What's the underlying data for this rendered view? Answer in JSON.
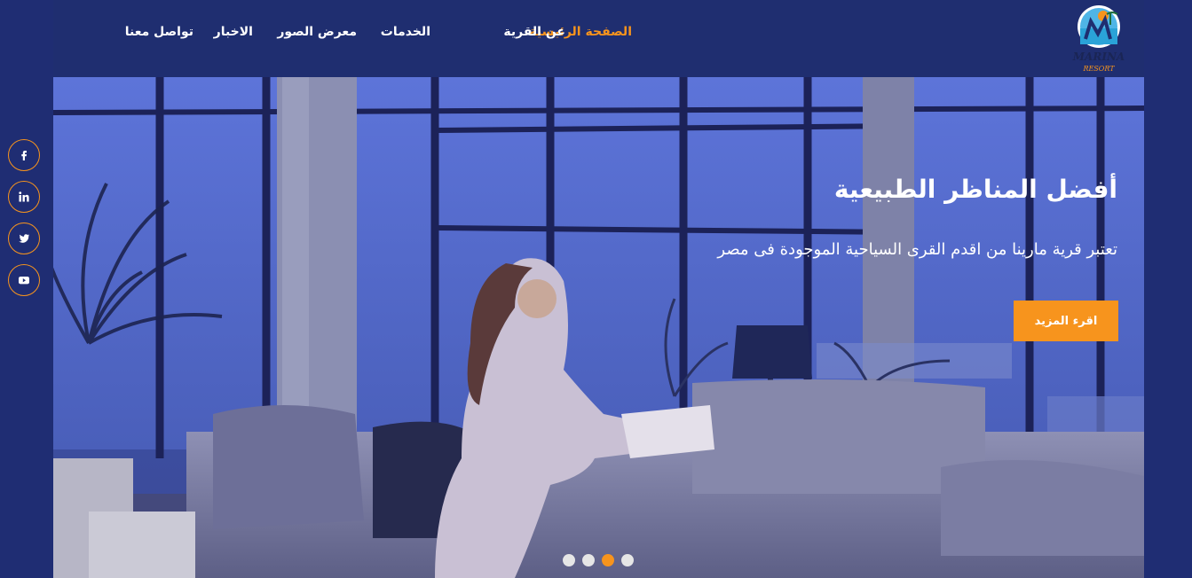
{
  "nav": {
    "items": [
      {
        "label": "الصفحة الرئيسية",
        "active": true
      },
      {
        "label": "عن القرية",
        "active": false
      },
      {
        "label": "الخدمات",
        "active": false
      },
      {
        "label": "معرض الصور",
        "active": false
      },
      {
        "label": "الاخبار",
        "active": false
      },
      {
        "label": "تواصل معنا",
        "active": false
      }
    ]
  },
  "logo": {
    "text": "MARINA",
    "subtext": "RESORT"
  },
  "hero": {
    "title": "أفضل المناظر الطبيعية",
    "subtitle": "تعتبر قرية مارينا من اقدم القرى السياحية الموجودة فى مصر",
    "button_label": "اقرء المزيد",
    "slider_active_index": 2,
    "slider_count": 4
  },
  "social": [
    "facebook-icon",
    "linkedin-icon",
    "twitter-icon",
    "youtube-icon"
  ],
  "colors": {
    "accent": "#f7941d",
    "background": "#1f2d73",
    "header": "#1f2e70",
    "text": "#ffffff"
  }
}
